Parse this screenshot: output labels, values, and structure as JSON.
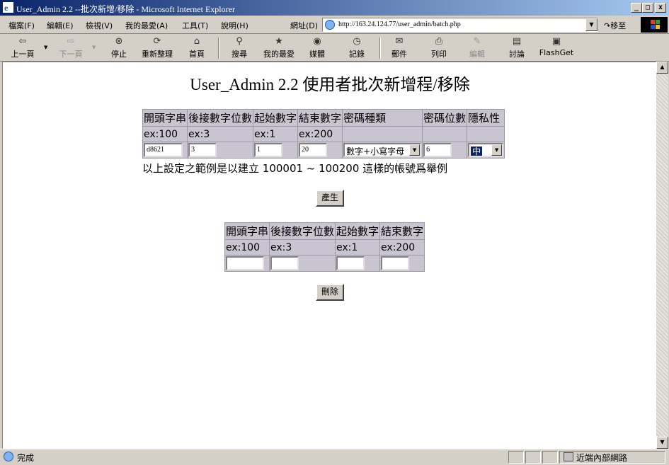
{
  "window": {
    "title": "User_Admin 2.2 --批次新增/移除 - Microsoft Internet Explorer",
    "min": "_",
    "max": "□",
    "close": "x"
  },
  "menu": [
    "檔案(F)",
    "編輯(E)",
    "檢視(V)",
    "我的最愛(A)",
    "工具(T)",
    "說明(H)"
  ],
  "address": {
    "label": "網址(D)",
    "url": "http://163.24.124.77/user_admin/batch.php",
    "go": "移至"
  },
  "toolbar": {
    "back": "上一頁",
    "forward": "下一頁",
    "stop": "停止",
    "refresh": "重新整理",
    "home": "首頁",
    "search": "搜尋",
    "favorites": "我的最愛",
    "media": "媒體",
    "history": "記錄",
    "mail": "郵件",
    "print": "列印",
    "edit": "編輯",
    "discuss": "討論",
    "flashget": "FlashGet"
  },
  "page": {
    "title": "User_Admin 2.2 使用者批次新增程/移除",
    "create_table": {
      "headers": [
        "開頭字串",
        "後接數字位數",
        "起始數字",
        "結束數字",
        "密碼種類",
        "密碼位數",
        "隱私性"
      ],
      "examples": [
        "ex:100",
        "ex:3",
        "ex:1",
        "ex:200",
        "",
        "",
        ""
      ],
      "values": {
        "prefix": "d8621",
        "digits": "3",
        "start": "1",
        "end": "20",
        "pw_type": "數字+小寫字母",
        "pw_length": "6",
        "privacy": "中"
      }
    },
    "note": "以上設定之範例是以建立 100001 ~ 100200 這樣的帳號爲舉例",
    "create_button": "產生",
    "delete_table": {
      "headers": [
        "開頭字串",
        "後接數字位數",
        "起始數字",
        "結束數字"
      ],
      "examples": [
        "ex:100",
        "ex:3",
        "ex:1",
        "ex:200"
      ],
      "values": {
        "prefix": "",
        "digits": "",
        "start": "",
        "end": ""
      }
    },
    "delete_button": "刪除"
  },
  "status": {
    "text": "完成",
    "zone": "近端內部網路"
  }
}
